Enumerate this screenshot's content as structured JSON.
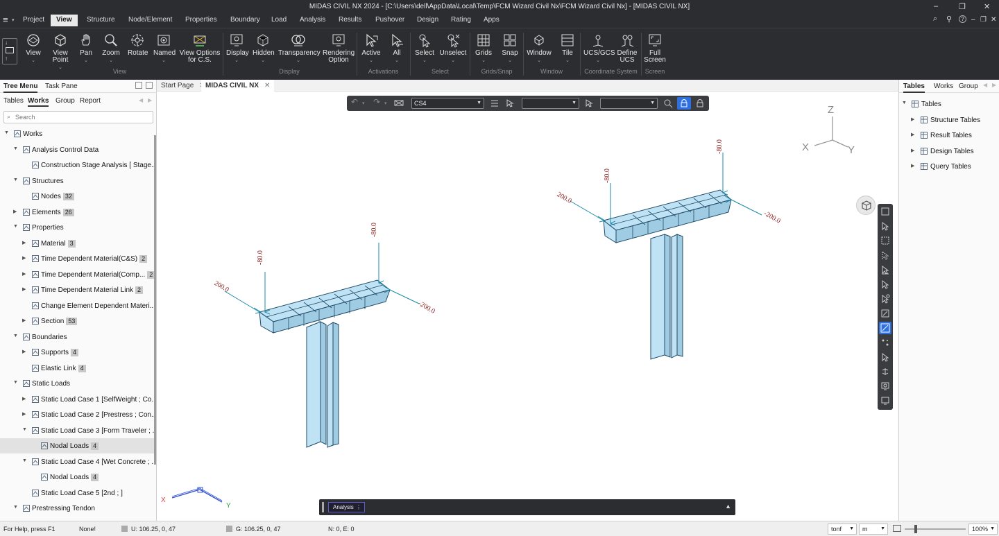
{
  "window": {
    "title": "MIDAS CIVIL NX 2024 - [C:\\Users\\dell\\AppData\\Local\\Temp\\FCM Wizard Civil Nx\\FCM Wizard Civil Nx] - [MIDAS CIVIL NX]",
    "minimize": "–",
    "restore": "❐",
    "close": "✕"
  },
  "menu": {
    "hamburger": "≡",
    "items": [
      "Project",
      "View",
      "Structure",
      "Node/Element",
      "Properties",
      "Boundary",
      "Load",
      "Analysis",
      "Results",
      "Pushover",
      "Design",
      "Rating",
      "Apps"
    ],
    "right_icons": [
      "⌕",
      "⚲",
      "?",
      "–",
      "❐",
      "✕"
    ]
  },
  "ribbon": {
    "buttons": [
      {
        "l1": "View",
        "l2": "",
        "dd": "⌄"
      },
      {
        "l1": "View",
        "l2": "Point",
        "dd": "⌄"
      },
      {
        "l1": "Pan",
        "l2": "",
        "dd": "⌄"
      },
      {
        "l1": "Zoom",
        "l2": "",
        "dd": "⌄"
      },
      {
        "l1": "Rotate",
        "l2": "",
        "dd": ""
      },
      {
        "l1": "Named",
        "l2": "",
        "dd": "⌄"
      },
      {
        "l1": "View Options",
        "l2": "for C.S.",
        "dd": ""
      },
      {
        "l1": "Display",
        "l2": "",
        "dd": "⌄"
      },
      {
        "l1": "Hidden",
        "l2": "",
        "dd": "⌄"
      },
      {
        "l1": "Transparency",
        "l2": "",
        "dd": "⌄"
      },
      {
        "l1": "Rendering",
        "l2": "Option",
        "dd": ""
      },
      {
        "l1": "Active",
        "l2": "",
        "dd": "⌄"
      },
      {
        "l1": "All",
        "l2": "",
        "dd": "⌄"
      },
      {
        "l1": "Select",
        "l2": "",
        "dd": "⌄"
      },
      {
        "l1": "Unselect",
        "l2": "",
        "dd": "⌄"
      },
      {
        "l1": "Grids",
        "l2": "",
        "dd": "⌄"
      },
      {
        "l1": "Snap",
        "l2": "",
        "dd": "⌄"
      },
      {
        "l1": "Window",
        "l2": "",
        "dd": "⌄"
      },
      {
        "l1": "Tile",
        "l2": "",
        "dd": "⌄"
      },
      {
        "l1": "UCS/GCS",
        "l2": "",
        "dd": "⌄"
      },
      {
        "l1": "Define",
        "l2": "UCS",
        "dd": ""
      },
      {
        "l1": "Full",
        "l2": "Screen",
        "dd": ""
      }
    ],
    "groups": [
      "View",
      "Display",
      "Activations",
      "Select",
      "Grids/Snap",
      "Window",
      "Coordinate System",
      "Screen"
    ]
  },
  "left_panel": {
    "tabs": [
      "Tree Menu",
      "Task Pane"
    ],
    "subtabs": [
      "Tables",
      "Works",
      "Group",
      "Report"
    ],
    "search_placeholder": "Search",
    "tree": [
      {
        "label": "Works",
        "badge": "",
        "arrow": "▼"
      },
      {
        "label": "Analysis Control Data",
        "badge": "",
        "arrow": "▼"
      },
      {
        "label": "Construction Stage Analysis [ Stage...",
        "badge": "",
        "arrow": ""
      },
      {
        "label": "Structures",
        "badge": "",
        "arrow": "▼"
      },
      {
        "label": "Nodes",
        "badge": "32",
        "arrow": ""
      },
      {
        "label": "Elements",
        "badge": "26",
        "arrow": "▶"
      },
      {
        "label": "Properties",
        "badge": "",
        "arrow": "▼"
      },
      {
        "label": "Material",
        "badge": "3",
        "arrow": "▶"
      },
      {
        "label": "Time Dependent Material(C&S)",
        "badge": "2",
        "arrow": "▶"
      },
      {
        "label": "Time Dependent Material(Comp...",
        "badge": "2",
        "arrow": "▶"
      },
      {
        "label": "Time Dependent Material Link",
        "badge": "2",
        "arrow": "▶"
      },
      {
        "label": "Change Element Dependent Materi...",
        "badge": "",
        "arrow": ""
      },
      {
        "label": "Section",
        "badge": "53",
        "arrow": "▶"
      },
      {
        "label": "Boundaries",
        "badge": "",
        "arrow": "▼"
      },
      {
        "label": "Supports",
        "badge": "4",
        "arrow": "▶"
      },
      {
        "label": "Elastic Link",
        "badge": "4",
        "arrow": ""
      },
      {
        "label": "Static Loads",
        "badge": "",
        "arrow": "▼"
      },
      {
        "label": "Static Load Case 1 [SelfWeight ; Co...",
        "badge": "",
        "arrow": "▶"
      },
      {
        "label": "Static Load Case 2 [Prestress ; Con...",
        "badge": "",
        "arrow": "▶"
      },
      {
        "label": "Static Load Case 3 [Form Traveler ; ...",
        "badge": "",
        "arrow": "▼"
      },
      {
        "label": "Nodal Loads",
        "badge": "4",
        "arrow": ""
      },
      {
        "label": "Static Load Case 4 [Wet Concrete ; ...",
        "badge": "",
        "arrow": "▼"
      },
      {
        "label": "Nodal Loads",
        "badge": "4",
        "arrow": ""
      },
      {
        "label": "Static Load Case 5 [2nd ; ]",
        "badge": "",
        "arrow": ""
      },
      {
        "label": "Prestressing Tendon",
        "badge": "",
        "arrow": "▼"
      }
    ]
  },
  "doc_tabs": [
    {
      "label": "Start Page",
      "close": "✕"
    },
    {
      "label": "MIDAS CIVIL NX",
      "close": "✕"
    }
  ],
  "viewport": {
    "stage_select": "CS4",
    "axis_labels": {
      "z": "Z",
      "x": "X",
      "y": "Y",
      "tx": "X",
      "ty": "Y"
    },
    "load_labels": {
      "left_moment_l": "200.0",
      "left_moment_r": "-200.0",
      "left_force_l": "-80.0",
      "left_force_r": "-80.0",
      "right_moment_l": "200.0",
      "right_moment_r": "-200.0",
      "right_force_l": "-80.0",
      "right_force_r": "-80.0"
    },
    "analysis_label": "Analysis",
    "analysis_caret": "⋮",
    "analysis_expand": "▲"
  },
  "right_panel": {
    "tabs": [
      "Tables",
      "Works",
      "Group"
    ],
    "tree": [
      {
        "label": "Tables",
        "arrow": "▼"
      },
      {
        "label": "Structure Tables",
        "arrow": "▶"
      },
      {
        "label": "Result Tables",
        "arrow": "▶"
      },
      {
        "label": "Design Tables",
        "arrow": "▶"
      },
      {
        "label": "Query Tables",
        "arrow": "▶"
      }
    ]
  },
  "status": {
    "help": "For Help, press F1",
    "none": "None!",
    "u": "U: 106.25, 0, 47",
    "g": "G: 106.25, 0, 47",
    "ne": "N: 0, E: 0",
    "force_unit": "tonf",
    "length_unit": "m",
    "zoom": "100%"
  },
  "colors": {
    "ribbon_bg": "#2b2d30",
    "member_fill": "#bfe3f5",
    "member_edge": "#1f4a66",
    "load_arrow": "#1a8aa8",
    "load_text": "#8b1a1a",
    "accent": "#2f6fe0"
  }
}
